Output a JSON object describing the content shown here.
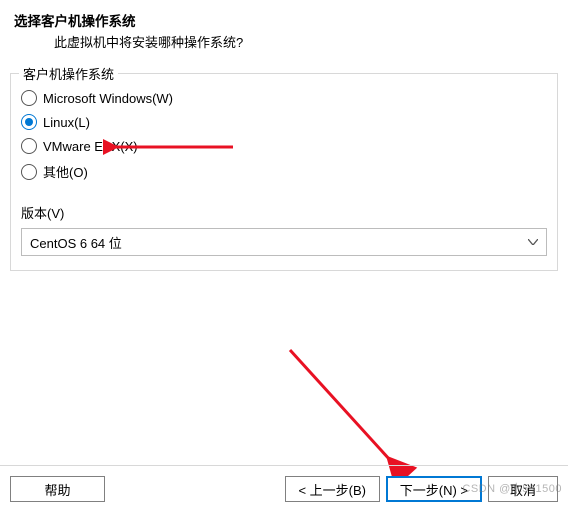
{
  "header": {
    "title": "选择客户机操作系统",
    "subtitle": "此虚拟机中将安装哪种操作系统?"
  },
  "osGroup": {
    "legend": "客户机操作系统",
    "options": [
      {
        "label": "Microsoft Windows(W)",
        "selected": false
      },
      {
        "label": "Linux(L)",
        "selected": true
      },
      {
        "label": "VMware ESX(X)",
        "selected": false
      },
      {
        "label": "其他(O)",
        "selected": false
      }
    ]
  },
  "version": {
    "label": "版本(V)",
    "selected": "CentOS 6 64 位"
  },
  "buttons": {
    "help": "帮助",
    "back": "< 上一步(B)",
    "next": "下一步(N) >",
    "cancel": "取消"
  },
  "watermark": "CSDN @水541500"
}
